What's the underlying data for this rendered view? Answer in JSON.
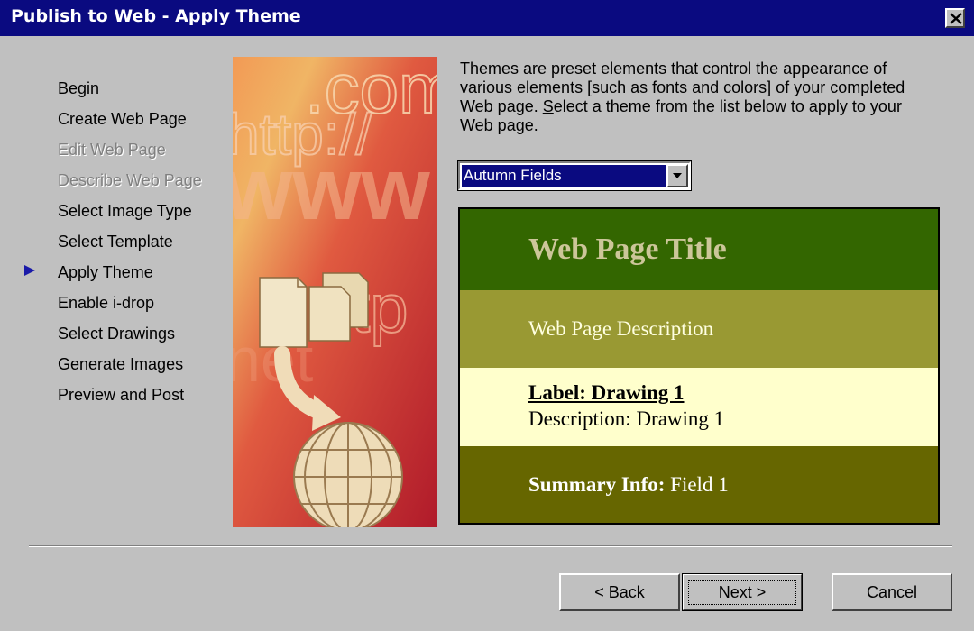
{
  "window": {
    "title": "Publish to Web - Apply Theme"
  },
  "steps": [
    {
      "label": "Begin",
      "enabled": true
    },
    {
      "label": "Create Web Page",
      "enabled": true
    },
    {
      "label": "Edit Web Page",
      "enabled": false
    },
    {
      "label": "Describe Web Page",
      "enabled": false
    },
    {
      "label": "Select Image Type",
      "enabled": true
    },
    {
      "label": "Select Template",
      "enabled": true
    },
    {
      "label": "Apply Theme",
      "enabled": true,
      "current": true
    },
    {
      "label": "Enable i-drop",
      "enabled": true
    },
    {
      "label": "Select Drawings",
      "enabled": true
    },
    {
      "label": "Generate Images",
      "enabled": true
    },
    {
      "label": "Preview and Post",
      "enabled": true
    }
  ],
  "side_graphic": {
    "text_com": ".com",
    "text_http": "http://",
    "text_www": "www",
    "text_ftp": "ftp",
    "text_net": "net"
  },
  "intro": {
    "text_before": "Themes are preset elements that control the appearance of various elements [such as fonts and colors] of your completed Web page.  ",
    "select_accel": "S",
    "text_after": "elect a theme from the list below to apply to your Web page."
  },
  "theme_select": {
    "value": "Autumn Fields"
  },
  "preview": {
    "title": "Web Page Title",
    "description": "Web Page Description",
    "label": "Label: Drawing 1",
    "drawing_description": "Description: Drawing 1",
    "summary_label": "Summary Info:",
    "summary_value": " Field 1",
    "colors": {
      "title_band": "#336600",
      "description_band": "#999933",
      "label_band": "#ffffcc",
      "summary_band": "#666600"
    }
  },
  "buttons": {
    "back_prefix": "< ",
    "back_accel": "B",
    "back_rest": "ack",
    "next_accel": "N",
    "next_rest": "ext >",
    "cancel": "Cancel"
  }
}
